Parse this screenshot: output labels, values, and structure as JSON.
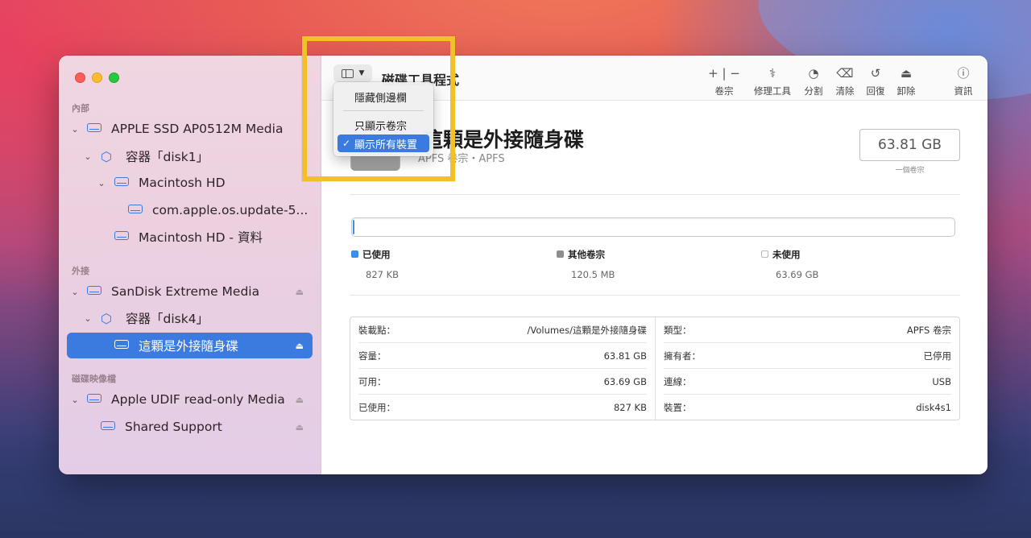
{
  "app": {
    "title": "磁碟工具程式"
  },
  "window_controls": [
    "close",
    "minimize",
    "zoom"
  ],
  "sidebar": {
    "sections": [
      {
        "label": "內部",
        "items": [
          {
            "label": "APPLE SSD AP0512M Media",
            "icon": "drive-icon",
            "expanded": true
          },
          {
            "label": "容器「disk1」",
            "icon": "container-icon",
            "expanded": true
          },
          {
            "label": "Macintosh HD",
            "icon": "volume-icon",
            "expanded": true
          },
          {
            "label": "com.apple.os.update-5...",
            "icon": "volume-icon"
          },
          {
            "label": "Macintosh HD - 資料",
            "icon": "volume-icon"
          }
        ]
      },
      {
        "label": "外接",
        "items": [
          {
            "label": "SanDisk Extreme Media",
            "icon": "drive-icon",
            "expanded": true,
            "eject": true
          },
          {
            "label": "容器「disk4」",
            "icon": "container-icon",
            "expanded": true
          },
          {
            "label": "這顆是外接隨身碟",
            "icon": "volume-icon",
            "selected": true,
            "eject": true
          }
        ]
      },
      {
        "label": "磁碟映像檔",
        "items": [
          {
            "label": "Apple UDIF read-only Media",
            "icon": "drive-icon",
            "expanded": true,
            "eject": true
          },
          {
            "label": "Shared Support",
            "icon": "volume-icon",
            "eject": true
          }
        ]
      }
    ]
  },
  "toolbar": {
    "add_remove": {
      "label": "卷宗",
      "add": "+",
      "remove": "−"
    },
    "first_aid": "修理工具",
    "partition": "分割",
    "erase": "清除",
    "restore": "回復",
    "unmount": "卸除",
    "info": "資訊"
  },
  "view_menu": {
    "items": [
      {
        "label": "隱藏側邊欄",
        "checked": false
      },
      {
        "label": "只顯示卷宗",
        "checked": false
      },
      {
        "label": "顯示所有裝置",
        "checked": true
      }
    ]
  },
  "volume": {
    "name": "這顆是外接隨身碟",
    "subtitle": "APFS 卷宗・APFS",
    "size": "63.81 GB",
    "size_caption": "一個卷宗"
  },
  "usage": {
    "legend": [
      {
        "name": "已使用",
        "value": "827 KB",
        "color": "#3b8fe8"
      },
      {
        "name": "其他卷宗",
        "value": "120.5 MB",
        "color": "#8e8e8e"
      },
      {
        "name": "未使用",
        "value": "63.69 GB",
        "color": "#ffffff"
      }
    ]
  },
  "info_table": {
    "left": [
      {
        "key": "裝載點：",
        "value": "/Volumes/這顆是外接隨身碟"
      },
      {
        "key": "容量：",
        "value": "63.81 GB"
      },
      {
        "key": "可用：",
        "value": "63.69 GB"
      },
      {
        "key": "已使用：",
        "value": "827 KB"
      }
    ],
    "right": [
      {
        "key": "類型：",
        "value": "APFS 卷宗"
      },
      {
        "key": "擁有者：",
        "value": "已停用"
      },
      {
        "key": "連線：",
        "value": "USB"
      },
      {
        "key": "裝置：",
        "value": "disk4s1"
      }
    ]
  }
}
